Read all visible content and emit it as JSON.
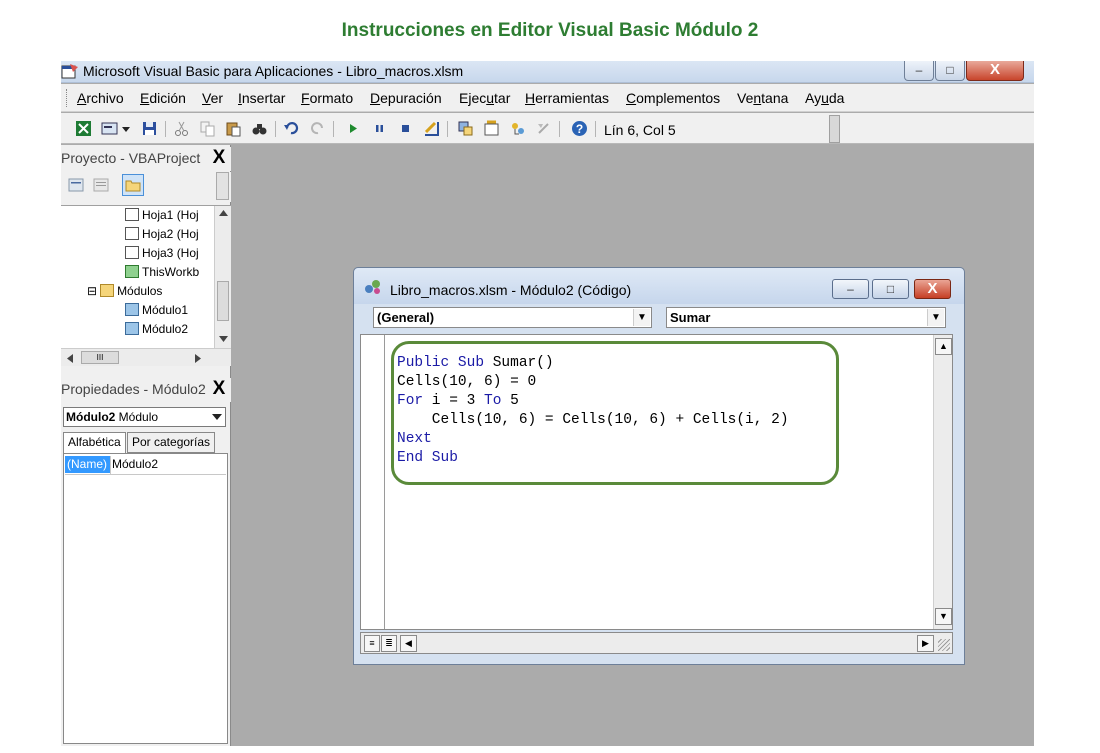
{
  "caption": "Instrucciones en Editor Visual Basic Módulo 2",
  "window": {
    "title": "Microsoft Visual Basic para Aplicaciones - Libro_macros.xlsm",
    "minimize": "–",
    "maximize": "□",
    "close": "X"
  },
  "menu": {
    "items": [
      {
        "pre": "",
        "u": "A",
        "post": "rchivo"
      },
      {
        "pre": "",
        "u": "E",
        "post": "dición"
      },
      {
        "pre": "",
        "u": "V",
        "post": "er"
      },
      {
        "pre": "",
        "u": "I",
        "post": "nsertar"
      },
      {
        "pre": "",
        "u": "F",
        "post": "ormato"
      },
      {
        "pre": "",
        "u": "D",
        "post": "epuración"
      },
      {
        "pre": "Ejec",
        "u": "u",
        "post": "tar"
      },
      {
        "pre": "",
        "u": "H",
        "post": "erramientas"
      },
      {
        "pre": "",
        "u": "C",
        "post": "omplementos"
      },
      {
        "pre": "Ve",
        "u": "n",
        "post": "tana"
      },
      {
        "pre": "Ay",
        "u": "u",
        "post": "da"
      }
    ]
  },
  "toolbar": {
    "status": "Lín 6, Col 5"
  },
  "project": {
    "title": "Proyecto - VBAProject",
    "close": "X",
    "tree": [
      {
        "label": "Hoja1 (Hoj",
        "icon": "sheet-icon"
      },
      {
        "label": "Hoja2 (Hoj",
        "icon": "sheet-icon"
      },
      {
        "label": "Hoja3 (Hoj",
        "icon": "sheet-icon"
      },
      {
        "label": "ThisWorkb",
        "icon": "workbook-icon"
      },
      {
        "label": "Módulos",
        "icon": "folder-icon"
      },
      {
        "label": "Módulo1",
        "icon": "module-icon"
      },
      {
        "label": "Módulo2",
        "icon": "module-icon"
      }
    ],
    "collapse_glyph": "⊟",
    "hscroll_thumb": "III"
  },
  "properties": {
    "title": "Propiedades - Módulo2",
    "close": "X",
    "object_name": "Módulo2",
    "object_type": "Módulo",
    "tabs": [
      "Alfabética",
      "Por categorías"
    ],
    "rows": [
      {
        "name": "(Name)",
        "value": "Módulo2"
      }
    ]
  },
  "code_window": {
    "title": "Libro_macros.xlsm - Módulo2 (Código)",
    "object_combo": "(General)",
    "proc_combo": "Sumar",
    "lines": [
      [
        {
          "t": "Public Sub",
          "k": true
        },
        {
          "t": " Sumar()",
          "k": false
        }
      ],
      [
        {
          "t": "Cells(10, 6) = 0",
          "k": false
        }
      ],
      [
        {
          "t": "For",
          "k": true
        },
        {
          "t": " i = 3 ",
          "k": false
        },
        {
          "t": "To",
          "k": true
        },
        {
          "t": " 5",
          "k": false
        }
      ],
      [
        {
          "t": "    Cells(10, 6) = Cells(10, 6) + Cells(i, 2)",
          "k": false
        }
      ],
      [
        {
          "t": "Next",
          "k": true
        }
      ],
      [
        {
          "t": "End Sub",
          "k": true
        }
      ]
    ]
  },
  "colors": {
    "caption": "#2e7d32",
    "keyword": "#1a1aa6",
    "highlight_border": "#5a8a3a",
    "workspace": "#ababab"
  }
}
